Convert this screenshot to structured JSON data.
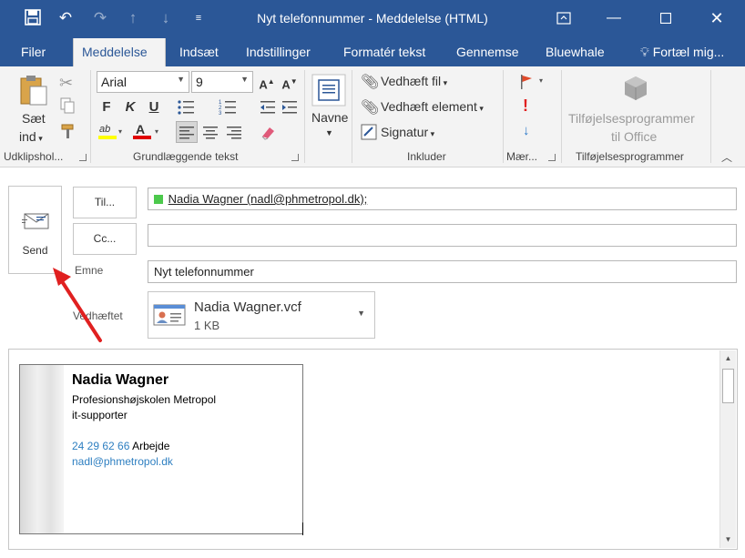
{
  "window": {
    "title": "Nyt telefonnummer  -  Meddelelse (HTML)"
  },
  "tabs": [
    {
      "label": "Filer"
    },
    {
      "label": "Meddelelse"
    },
    {
      "label": "Indsæt"
    },
    {
      "label": "Indstillinger"
    },
    {
      "label": "Formatér tekst"
    },
    {
      "label": "Gennemse"
    },
    {
      "label": "Bluewhale"
    },
    {
      "label": "Fortæl mig..."
    }
  ],
  "ribbon": {
    "clipboard": {
      "paste_line1": "Sæt",
      "paste_line2": "ind",
      "label": "Udklipshol..."
    },
    "basic_text": {
      "font_name": "Arial",
      "font_size": "9",
      "bold": "F",
      "italic": "K",
      "underline": "U",
      "label": "Grundlæggende tekst"
    },
    "names": {
      "label": "Navne"
    },
    "include": {
      "attach_file": "Vedhæft fil",
      "attach_item": "Vedhæft element",
      "signature": "Signatur",
      "label": "Inkluder"
    },
    "tags": {
      "label": "Mær..."
    },
    "addins": {
      "button_line1": "Tilføjelsesprogrammer",
      "button_line2": "til Office",
      "label": "Tilføjelsesprogrammer"
    }
  },
  "compose": {
    "send_label": "Send",
    "to_button": "Til...",
    "cc_button": "Cc...",
    "to_value": "Nadia Wagner (nadl@phmetropol.dk);",
    "cc_value": "",
    "subject_label": "Emne",
    "subject_value": "Nyt telefonnummer",
    "attached_label": "Vedhæftet",
    "attachment": {
      "name": "Nadia Wagner.vcf",
      "size": "1 KB"
    }
  },
  "card": {
    "name": "Nadia Wagner",
    "org": "Profesionshøjskolen Metropol",
    "title": "it-supporter",
    "phone": "24 29 62 66",
    "phone_type": "Arbejde",
    "email": "nadl@phmetropol.dk"
  },
  "colors": {
    "accent": "#2b5797",
    "annotation_arrow": "#e02020",
    "recipient_status": "#4cc94c"
  }
}
